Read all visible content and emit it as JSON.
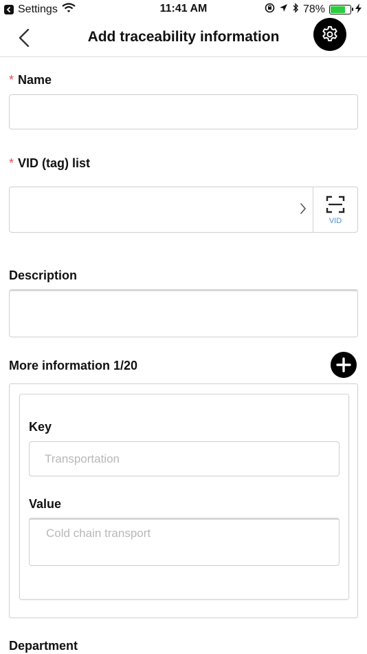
{
  "status_bar": {
    "carrier": "Settings",
    "time": "11:41 AM",
    "battery_percent": "78%",
    "battery_level": 0.78,
    "icons": [
      "back-to-app-icon",
      "wifi-icon",
      "orientation-lock-icon",
      "location-icon",
      "bluetooth-icon",
      "battery-icon",
      "charging-icon"
    ]
  },
  "nav": {
    "title": "Add traceability information",
    "back_icon": "chevron-left-icon",
    "settings_icon": "gear-icon"
  },
  "form": {
    "name": {
      "required_mark": "*",
      "label": "Name",
      "value": "",
      "placeholder": ""
    },
    "vid_list": {
      "required_mark": "*",
      "label": "VID (tag) list",
      "value": "",
      "scan_label": "VID"
    },
    "description": {
      "label": "Description",
      "value": "",
      "placeholder": ""
    },
    "more_info": {
      "label": "More information 1/20",
      "entries": [
        {
          "key_label": "Key",
          "key_placeholder": "Transportation",
          "value_label": "Value",
          "value_placeholder": "Cold chain transport"
        }
      ]
    },
    "department": {
      "label": "Department"
    }
  },
  "colors": {
    "required": "#e84c4c",
    "accent_link": "#4a8fd6",
    "battery": "#2ecc40",
    "border": "#cfcfcf"
  }
}
